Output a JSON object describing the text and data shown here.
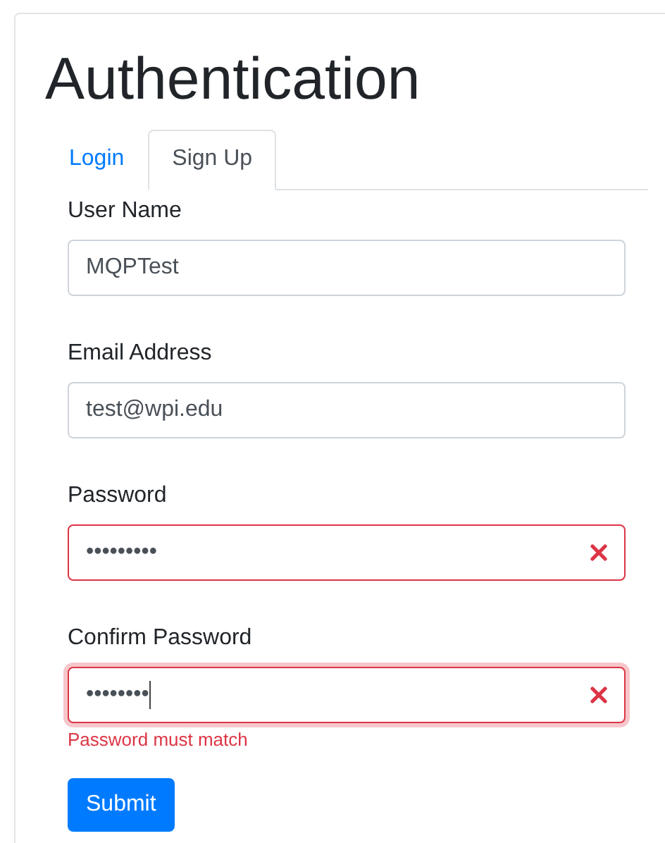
{
  "title": "Authentication",
  "tabs": [
    {
      "label": "Login",
      "selected": false
    },
    {
      "label": "Sign Up",
      "selected": true
    }
  ],
  "fields": [
    {
      "label": "User Name",
      "value": "MQPTest",
      "invalid": false,
      "focused": false
    },
    {
      "label": "Email Address",
      "value": "test@wpi.edu",
      "invalid": false,
      "focused": false
    },
    {
      "label": "Password",
      "value": "•••••••••",
      "invalid": true,
      "focused": false
    },
    {
      "label": "Confirm Password",
      "value": "••••••••",
      "invalid": true,
      "focused": true,
      "error": "Password must match"
    }
  ],
  "submit": "Submit"
}
